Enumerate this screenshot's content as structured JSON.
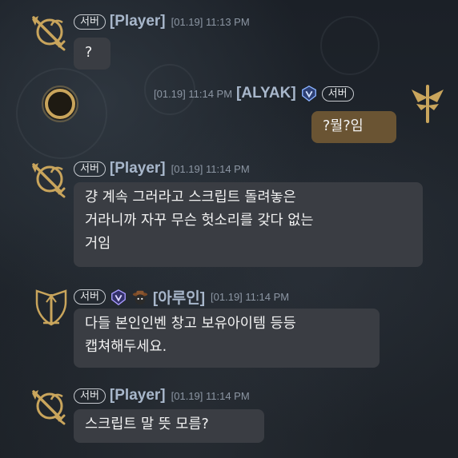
{
  "colors": {
    "background": "#1b2027",
    "bubble_other": "#3a3d43",
    "bubble_self": "#6a5433",
    "name_color": "#a8b7cb",
    "timestamp_color": "#8c96a3",
    "badge_border": "#c7cbd0",
    "gold_icon": "#c9a55c"
  },
  "messages": [
    {
      "badge": "서버",
      "sender": "[Player]",
      "timestamp": "[01.19] 11:13 PM",
      "text_lines": [
        "?"
      ],
      "avatar_icon": "crossed-swords-emblem-icon"
    },
    {
      "badge": "서버",
      "sender": "[ALYAK]",
      "timestamp": "[01.19] 11:14 PM",
      "text_lines": [
        "?뭘?임"
      ],
      "avatar_icon": "gold-wings-emblem-icon",
      "rank_icon": "blue-crest-icon",
      "self": true
    },
    {
      "badge": "서버",
      "sender": "[Player]",
      "timestamp": "[01.19] 11:14 PM",
      "text_lines": [
        "걍 계속 그러라고 스크립트 돌려놓은",
        "거라니까 자꾸 무슨 헛소리를 갖다 없는",
        "거임"
      ],
      "avatar_icon": "crossed-swords-emblem-icon"
    },
    {
      "badge": "서버",
      "sender": "[아루인]",
      "timestamp": "[01.19] 11:14 PM",
      "text_lines": [
        "다들 본인인벤 창고 보유아이템 등등",
        "캡쳐해두세요."
      ],
      "avatar_icon": "tower-shield-emblem-icon",
      "rank_icon": "purple-crest-icon",
      "pet_icon": "cowboy-mascot-icon"
    },
    {
      "badge": "서버",
      "sender": "[Player]",
      "timestamp": "[01.19] 11:14 PM",
      "text_lines": [
        "스크립트 말 뜻 모름?"
      ],
      "avatar_icon": "crossed-swords-emblem-icon"
    }
  ]
}
